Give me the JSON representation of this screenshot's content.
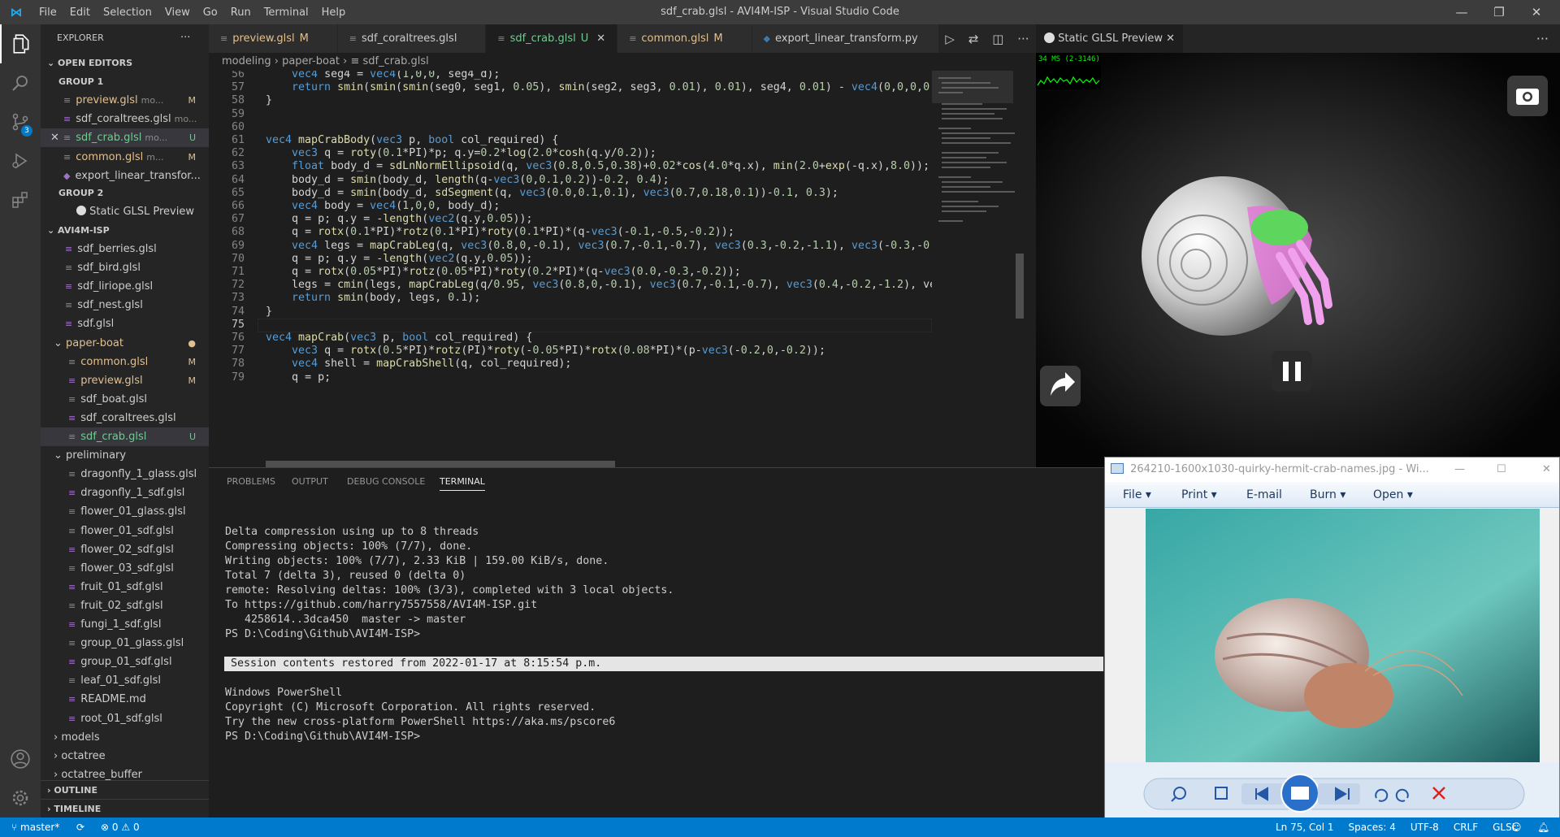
{
  "titlebar": {
    "title": "sdf_crab.glsl - AVI4M-ISP - Visual Studio Code",
    "menu": [
      "File",
      "Edit",
      "Selection",
      "View",
      "Go",
      "Run",
      "Terminal",
      "Help"
    ],
    "minimize": "—",
    "restore": "❐",
    "close": "✕"
  },
  "activity": {
    "scm_badge": "3"
  },
  "explorer": {
    "header": "EXPLORER",
    "more": "···",
    "open_editors": "OPEN EDITORS",
    "group1": "GROUP 1",
    "group2": "GROUP 2",
    "open1": [
      {
        "name": "preview.glsl",
        "dir": "mo...",
        "status": "M"
      },
      {
        "name": "sdf_coraltrees.glsl",
        "dir": "mo...",
        "status": ""
      },
      {
        "name": "sdf_crab.glsl",
        "dir": "mo...",
        "status": "U"
      },
      {
        "name": "common.glsl",
        "dir": "m...",
        "status": "M"
      },
      {
        "name": "export_linear_transfor...",
        "dir": "",
        "status": ""
      }
    ],
    "open2": [
      {
        "name": "Static GLSL Preview"
      }
    ],
    "project": "AVI4M-ISP",
    "files_top": [
      "sdf_berries.glsl",
      "sdf_bird.glsl",
      "sdf_liriope.glsl",
      "sdf_nest.glsl",
      "sdf.glsl"
    ],
    "folder_paper": "paper-boat",
    "paper_files": [
      {
        "name": "common.glsl",
        "status": "M"
      },
      {
        "name": "preview.glsl",
        "status": "M"
      },
      {
        "name": "sdf_boat.glsl",
        "status": ""
      },
      {
        "name": "sdf_coraltrees.glsl",
        "status": ""
      },
      {
        "name": "sdf_crab.glsl",
        "status": "U"
      }
    ],
    "folder_pre": "preliminary",
    "pre_files": [
      "dragonfly_1_glass.glsl",
      "dragonfly_1_sdf.glsl",
      "flower_01_glass.glsl",
      "flower_01_sdf.glsl",
      "flower_02_sdf.glsl",
      "flower_03_sdf.glsl",
      "fruit_01_sdf.glsl",
      "fruit_02_sdf.glsl",
      "fungi_1_sdf.glsl",
      "group_01_glass.glsl",
      "group_01_sdf.glsl",
      "leaf_01_sdf.glsl",
      "README.md",
      "root_01_sdf.glsl"
    ],
    "folders_bottom": [
      "models",
      "octatree",
      "octatree_buffer"
    ],
    "outline": "OUTLINE",
    "timeline": "TIMELINE"
  },
  "tabs": [
    {
      "label": "preview.glsl",
      "status": "M",
      "cls": "mod"
    },
    {
      "label": "sdf_coraltrees.glsl",
      "status": "",
      "cls": ""
    },
    {
      "label": "sdf_crab.glsl",
      "status": "U",
      "cls": "unt"
    },
    {
      "label": "common.glsl",
      "status": "M",
      "cls": "mod"
    },
    {
      "label": "export_linear_transform.py",
      "status": "",
      "cls": ""
    }
  ],
  "breadcrumb": [
    "modeling",
    "paper-boat",
    "sdf_crab.glsl"
  ],
  "code": [
    {
      "n": "56",
      "t": "    vec4 seg4 = vec4(1,0,0, seg4_d);"
    },
    {
      "n": "57",
      "t": "    return smin(smin(smin(seg0, seg1, 0.05), smin(seg2, seg3, 0.01), 0.01), seg4, 0.01) - vec4(0,0,0,0"
    },
    {
      "n": "58",
      "t": "}"
    },
    {
      "n": "59",
      "t": ""
    },
    {
      "n": "60",
      "t": ""
    },
    {
      "n": "61",
      "t": "vec4 mapCrabBody(vec3 p, bool col_required) {"
    },
    {
      "n": "62",
      "t": "    vec3 q = roty(0.1*PI)*p; q.y=0.2*log(2.0*cosh(q.y/0.2));"
    },
    {
      "n": "63",
      "t": "    float body_d = sdLnNormEllipsoid(q, vec3(0.8,0.5,0.38)+0.02*cos(4.0*q.x), min(2.0+exp(-q.x),8.0));"
    },
    {
      "n": "64",
      "t": "    body_d = smin(body_d, length(q-vec3(0,0.1,0.2))-0.2, 0.4);"
    },
    {
      "n": "65",
      "t": "    body_d = smin(body_d, sdSegment(q, vec3(0.0,0.1,0.1), vec3(0.7,0.18,0.1))-0.1, 0.3);"
    },
    {
      "n": "66",
      "t": "    vec4 body = vec4(1,0,0, body_d);"
    },
    {
      "n": "67",
      "t": "    q = p; q.y = -length(vec2(q.y,0.05));"
    },
    {
      "n": "68",
      "t": "    q = rotx(0.1*PI)*rotz(0.1*PI)*roty(0.1*PI)*(q-vec3(-0.1,-0.5,-0.2));"
    },
    {
      "n": "69",
      "t": "    vec4 legs = mapCrabLeg(q, vec3(0.8,0,-0.1), vec3(0.7,-0.1,-0.7), vec3(0.3,-0.2,-1.1), vec3(-0.3,-0"
    },
    {
      "n": "70",
      "t": "    q = p; q.y = -length(vec2(q.y,0.05));"
    },
    {
      "n": "71",
      "t": "    q = rotx(0.05*PI)*rotz(0.05*PI)*roty(0.2*PI)*(q-vec3(0.0,-0.3,-0.2));"
    },
    {
      "n": "72",
      "t": "    legs = cmin(legs, mapCrabLeg(q/0.95, vec3(0.8,0,-0.1), vec3(0.7,-0.1,-0.7), vec3(0.4,-0.2,-1.2), ve"
    },
    {
      "n": "73",
      "t": "    return smin(body, legs, 0.1);"
    },
    {
      "n": "74",
      "t": "}"
    },
    {
      "n": "75",
      "t": ""
    },
    {
      "n": "76",
      "t": "vec4 mapCrab(vec3 p, bool col_required) {"
    },
    {
      "n": "77",
      "t": "    vec3 q = rotx(0.5*PI)*rotz(PI)*roty(-0.05*PI)*rotx(0.08*PI)*(p-vec3(-0.2,0,-0.2));"
    },
    {
      "n": "78",
      "t": "    vec4 shell = mapCrabShell(q, col_required);"
    },
    {
      "n": "79",
      "t": "    q = p;"
    }
  ],
  "panel": {
    "tabs": [
      "PROBLEMS",
      "OUTPUT",
      "DEBUG CONSOLE",
      "TERMINAL"
    ],
    "terminal_lines": [
      "Delta compression using up to 8 threads",
      "Compressing objects: 100% (7/7), done.",
      "Writing objects: 100% (7/7), 2.33 KiB | 159.00 KiB/s, done.",
      "Total 7 (delta 3), reused 0 (delta 0)",
      "remote: Resolving deltas: 100% (3/3), completed with 3 local objects.",
      "To https://github.com/harry7557558/AVI4M-ISP.git",
      "   4258614..3dca450  master -> master",
      "PS D:\\Coding\\Github\\AVI4M-ISP>"
    ],
    "session": " Session contents restored from 2022-01-17 at 8:15:54 p.m.",
    "terminal_lines2": [
      "Windows PowerShell",
      "Copyright (C) Microsoft Corporation. All rights reserved.",
      "",
      "Try the new cross-platform PowerShell https://aka.ms/pscore6",
      "",
      "PS D:\\Coding\\Github\\AVI4M-ISP>"
    ]
  },
  "preview": {
    "tab": "Static GLSL Preview",
    "fps": "34 MS (2-3146)"
  },
  "viewer": {
    "title": "264210-1600x1030-quirky-hermit-crab-names.jpg - Wi...",
    "menu": [
      "File",
      "Print",
      "E-mail",
      "Burn",
      "Open"
    ]
  },
  "status": {
    "branch": "master*",
    "problems": "0",
    "warnings": "0",
    "right": [
      "Ln 75, Col 1",
      "Spaces: 4",
      "UTF-8",
      "CRLF",
      "GLSL"
    ]
  }
}
